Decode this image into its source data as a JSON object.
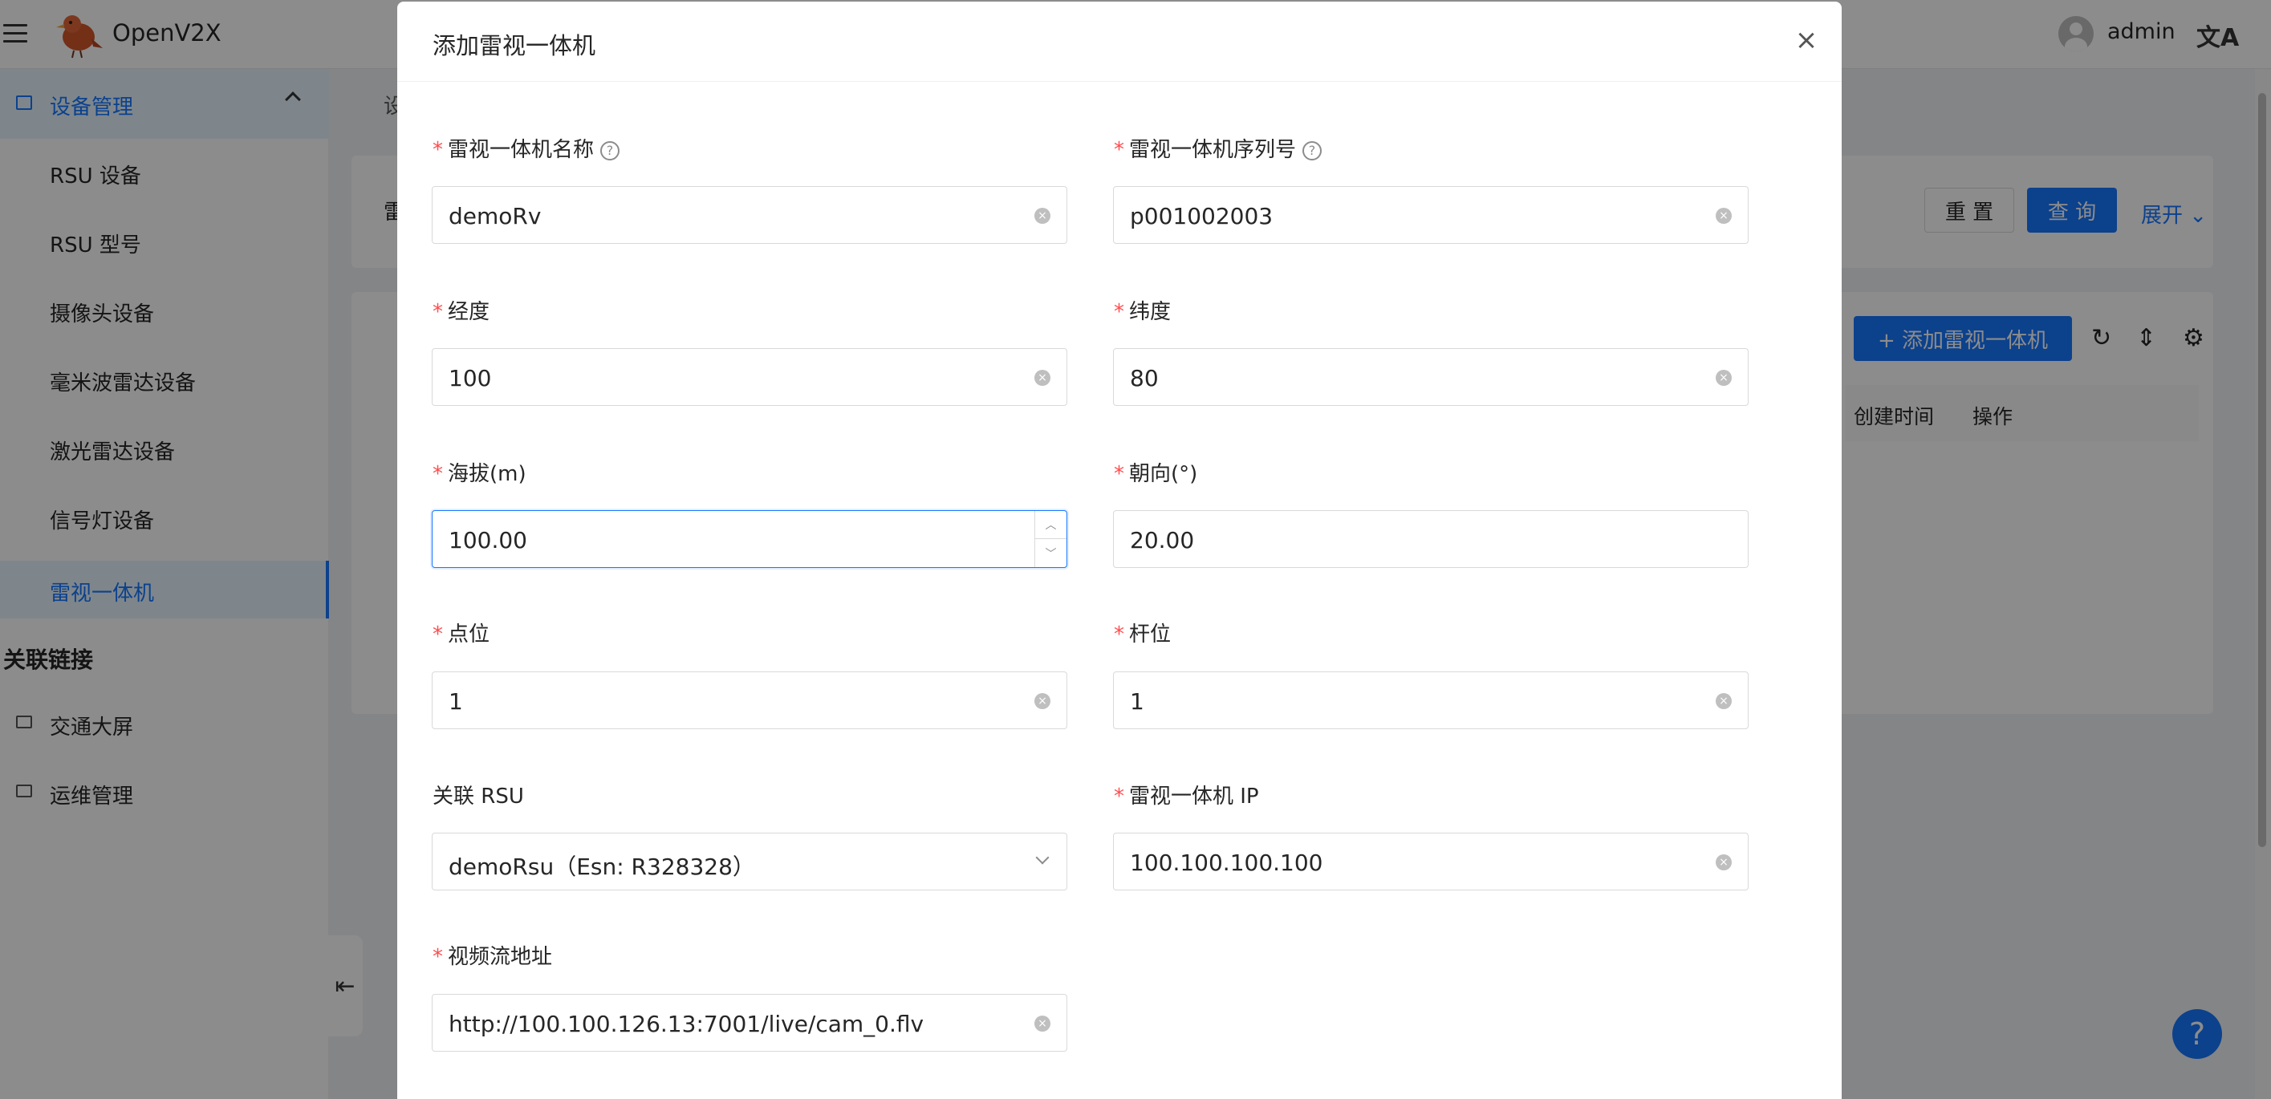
{
  "app": {
    "title": "OpenV2X"
  },
  "header": {
    "username": "admin",
    "lang_icon": "文A"
  },
  "sidebar": {
    "group_label": "设备管理",
    "items": [
      {
        "label": "RSU 设备"
      },
      {
        "label": "RSU 型号"
      },
      {
        "label": "摄像头设备"
      },
      {
        "label": "毫米波雷达设备"
      },
      {
        "label": "激光雷达设备"
      },
      {
        "label": "信号灯设备"
      },
      {
        "label": "雷视一体机"
      }
    ],
    "section_title": "关联链接",
    "links": [
      {
        "label": "交通大屏"
      },
      {
        "label": "运维管理"
      }
    ]
  },
  "background": {
    "reset_label": "重 置",
    "query_label": "查 询",
    "expand_label": "展开",
    "add_button_label": "+ 添加雷视一体机",
    "col_created": "创建时间",
    "col_actions": "操作",
    "partial_tab": "设",
    "partial_filter": "雷"
  },
  "modal": {
    "title": "添加雷视一体机",
    "fields": {
      "name": {
        "label": "雷视一体机名称",
        "value": "demoRv",
        "required": true
      },
      "serial": {
        "label": "雷视一体机序列号",
        "value": "p001002003",
        "required": true
      },
      "longitude": {
        "label": "经度",
        "value": "100",
        "required": true
      },
      "latitude": {
        "label": "纬度",
        "value": "80",
        "required": true
      },
      "altitude": {
        "label": "海拔(m)",
        "value": "100.00",
        "required": true
      },
      "heading": {
        "label": "朝向(°)",
        "value": "20.00",
        "required": true
      },
      "point": {
        "label": "点位",
        "value": "1",
        "required": true
      },
      "pole": {
        "label": "杆位",
        "value": "1",
        "required": true
      },
      "rsu": {
        "label": "关联 RSU",
        "value": "demoRsu（Esn: R328328）",
        "required": false
      },
      "ip": {
        "label": "雷视一体机 IP",
        "value": "100.100.100.100",
        "required": true
      },
      "stream": {
        "label": "视频流地址",
        "value": "http://100.100.126.13:7001/live/cam_0.flv",
        "required": true
      }
    }
  },
  "colors": {
    "primary": "#1677ff",
    "required": "#ff4d4f",
    "mask": "rgba(0,0,0,0.45)"
  }
}
